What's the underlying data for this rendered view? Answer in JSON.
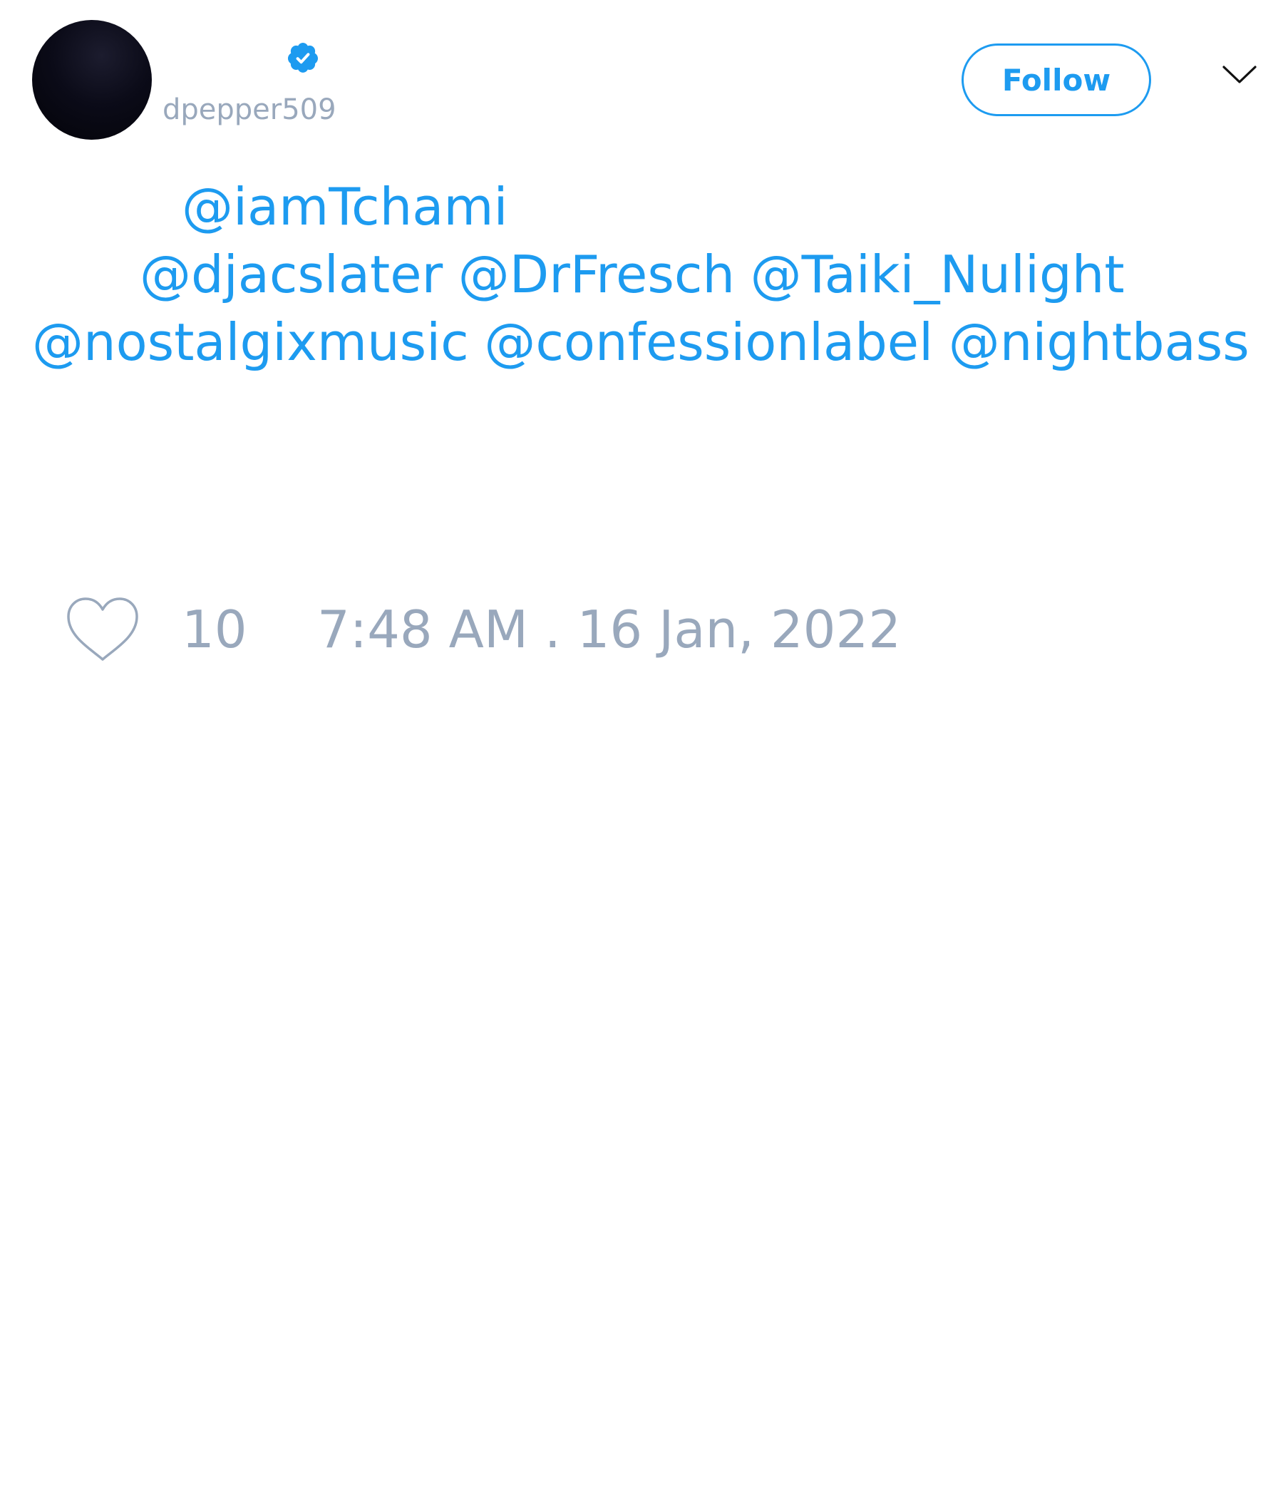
{
  "author": {
    "handle": "dpepper509",
    "verified": true,
    "avatar_icon": "avatar-image"
  },
  "actions": {
    "follow_label": "Follow",
    "menu_icon": "chevron-down-icon"
  },
  "tweet": {
    "lines": [
      [
        "@iamTchami"
      ],
      [
        "@djacslater",
        "@DrFresch",
        "@Taiki_Nulight"
      ],
      [
        "@nostalgixmusic",
        "@confessionlabel",
        "@nightbass"
      ]
    ]
  },
  "stats": {
    "like_icon": "heart-icon",
    "likes": "10",
    "timestamp": "7:48 AM . 16 Jan, 2022"
  },
  "colors": {
    "accent": "#1d9bf0",
    "muted": "#99a8bc",
    "background": "#ffffff"
  }
}
